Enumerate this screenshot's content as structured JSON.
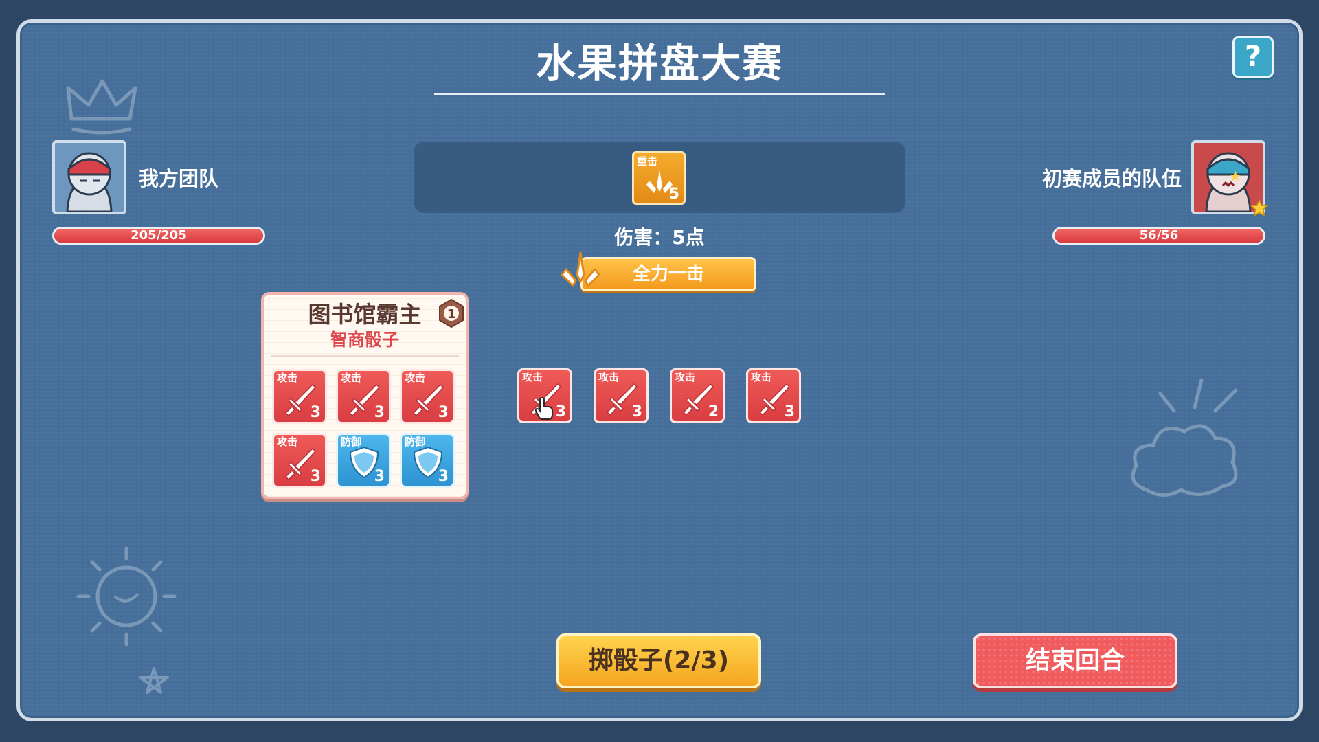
{
  "header": {
    "title": "水果拼盘大赛",
    "help_label": "?"
  },
  "my_team": {
    "name": "我方团队",
    "hp_text": "205/205",
    "hp_fraction": 1.0,
    "avatar_icon": "ninja-character-avatar"
  },
  "enemy_team": {
    "name": "初赛成员的队伍",
    "hp_text": "56/56",
    "hp_fraction": 1.0,
    "avatar_icon": "ninja-enemy-avatar"
  },
  "skill": {
    "label": "重击",
    "value": "5",
    "damage_text": "伤害：5点",
    "action_label": "全力一击",
    "icon": "heavy-strike-icon"
  },
  "character": {
    "name": "图书馆霸主",
    "dice_class": "智商骰子",
    "level": "1",
    "dice": [
      {
        "type": "攻击",
        "value": "3",
        "kind": "attack"
      },
      {
        "type": "攻击",
        "value": "3",
        "kind": "attack"
      },
      {
        "type": "攻击",
        "value": "3",
        "kind": "attack"
      },
      {
        "type": "攻击",
        "value": "3",
        "kind": "attack"
      },
      {
        "type": "防御",
        "value": "3",
        "kind": "defense"
      },
      {
        "type": "防御",
        "value": "3",
        "kind": "defense"
      }
    ]
  },
  "rolled_dice": [
    {
      "type": "攻击",
      "value": "3",
      "kind": "attack"
    },
    {
      "type": "攻击",
      "value": "3",
      "kind": "attack"
    },
    {
      "type": "攻击",
      "value": "2",
      "kind": "attack"
    },
    {
      "type": "攻击",
      "value": "3",
      "kind": "attack"
    }
  ],
  "actions": {
    "roll_label": "掷骰子(2/3)",
    "end_turn_label": "结束回合"
  },
  "colors": {
    "attack": "#e34a4c",
    "defense": "#3ea5e0",
    "gold": "#f5a51f",
    "board": "#46709b"
  }
}
